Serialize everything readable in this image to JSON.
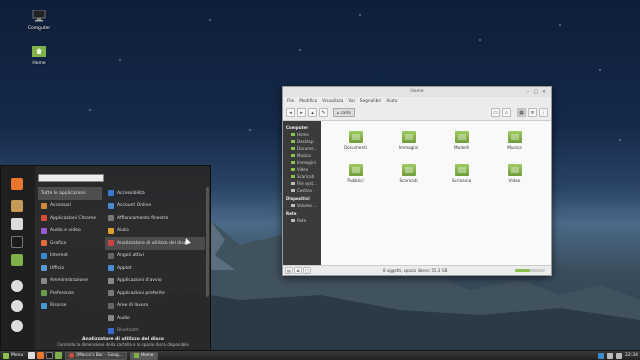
{
  "desktop": {
    "icons": [
      {
        "label": "Computer",
        "icon": "computer-icon"
      },
      {
        "label": "Home",
        "icon": "home-folder-icon"
      }
    ]
  },
  "file_manager": {
    "title": "Home",
    "menu": [
      "File",
      "Modifica",
      "Visualizza",
      "Vai",
      "Segnalibri",
      "Aiuto"
    ],
    "breadcrumb": "carlo",
    "sidebar": {
      "computer_header": "Computer",
      "computer_items": [
        "Home",
        "Desktop",
        "Docume...",
        "Musica",
        "Immagini",
        "Video",
        "Scaricati",
        "File syst...",
        "Cestino"
      ],
      "devices_header": "Dispositivi",
      "devices_items": [
        "Volume ..."
      ],
      "network_header": "Rete",
      "network_items": [
        "Rete"
      ]
    },
    "folders": [
      "Documenti",
      "Immagini",
      "Modelli",
      "Musica",
      "Pubblici",
      "Scaricati",
      "Scrivania",
      "Video"
    ],
    "status": "8 oggetti, spazio libero: 55,3 GB",
    "zoom_level": 0.5
  },
  "menu": {
    "search_value": "",
    "categories": [
      {
        "label": "Tutte le applicazioni",
        "color": "#555555"
      },
      {
        "label": "Accessori",
        "color": "#d08a3a"
      },
      {
        "label": "Applicazioni Chrome",
        "color": "#d84a3a"
      },
      {
        "label": "Audio e video",
        "color": "#9b5bd0"
      },
      {
        "label": "Grafica",
        "color": "#e06a3a"
      },
      {
        "label": "Internet",
        "color": "#3a8ad0"
      },
      {
        "label": "Ufficio",
        "color": "#5a9ad0"
      },
      {
        "label": "Amministrazione",
        "color": "#888888"
      },
      {
        "label": "Preferenze",
        "color": "#6a9a4a"
      },
      {
        "label": "Risorse",
        "color": "#4a9ad0"
      }
    ],
    "apps": [
      {
        "label": "Accessibilità",
        "color": "#3a7ad0"
      },
      {
        "label": "Account Online",
        "color": "#4a8ad0"
      },
      {
        "label": "Affiancamento finestre",
        "color": "#777777"
      },
      {
        "label": "Aiuto",
        "color": "#e0a030"
      },
      {
        "label": "Analizzatore di utilizzo del disco",
        "color": "#cc4444"
      },
      {
        "label": "Angoli attivi",
        "color": "#666666"
      },
      {
        "label": "Applet",
        "color": "#4a8ad0"
      },
      {
        "label": "Applicazioni d'avvio",
        "color": "#888888"
      },
      {
        "label": "Applicazioni preferite",
        "color": "#7a7a7a"
      },
      {
        "label": "Aree di lavoro",
        "color": "#666666"
      },
      {
        "label": "Audio",
        "color": "#888888"
      },
      {
        "label": "Bluetooth",
        "color": "#3a6ad0"
      }
    ],
    "selected_app_title": "Analizzatore di utilizzo del disco",
    "selected_app_description": "Controlla la dimensione della cartella e lo spazio disco disponibile"
  },
  "taskbar": {
    "menu_label": "Menu",
    "tasks": [
      {
        "label": "[Marco's Bar - Goog...",
        "active": false
      },
      {
        "label": "Home",
        "active": true
      }
    ],
    "clock": "22:34"
  }
}
